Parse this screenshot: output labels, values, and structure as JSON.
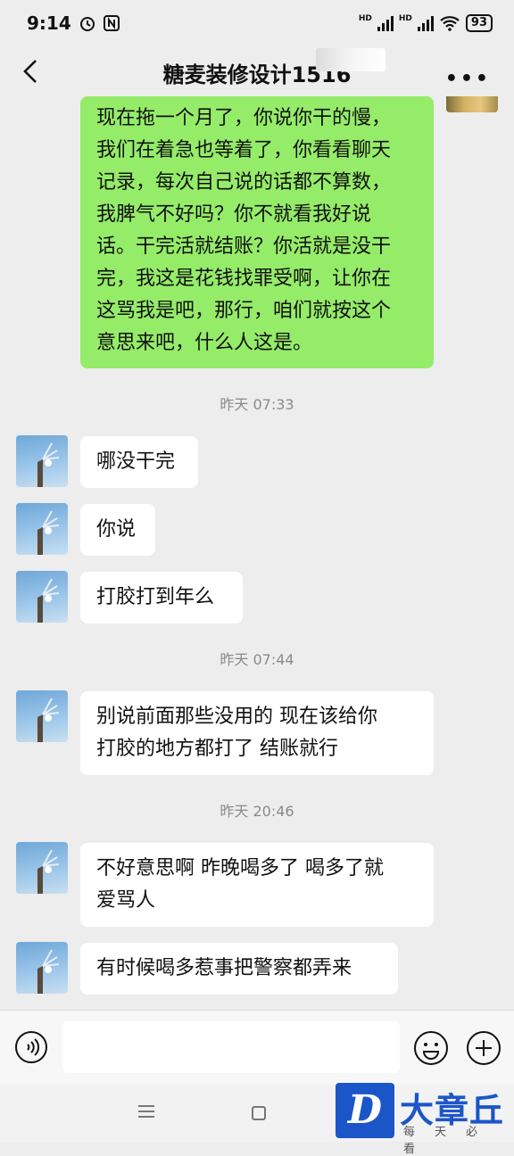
{
  "status_bar": {
    "time": "9:14",
    "battery": "93",
    "net1": "HD",
    "net2": "HD"
  },
  "header": {
    "title": "糖麦装修设计1516"
  },
  "messages": {
    "m1": "现在拖一个月了，你说你干的慢，\n我们在着急也等着了，你看看聊天\n记录，每次自己说的话都不算数，\n我脾气不好吗？你不就看我好说\n话。干完活就结账？你活就是没干\n完，我这是花钱找罪受啊，让你在\n这骂我是吧，那行，咱们就按这个\n意思来吧，什么人这是。",
    "t1": "昨天 07:33",
    "m2": "哪没干完",
    "m3": "你说",
    "m4": "打胶打到年么",
    "t2": "昨天 07:44",
    "m5": "别说前面那些没用的 现在该给你\n打胶的地方都打了 结账就行",
    "t3": "昨天 20:46",
    "m6": "不好意思啊 昨晚喝多了 喝多了就\n爱骂人",
    "m7": "有时候喝多惹事把警察都弄来"
  },
  "watermark": {
    "logo": "D",
    "name": "大章丘",
    "sub": "每天必看"
  },
  "colors": {
    "outgoing": "#95ec69",
    "incoming": "#ffffff",
    "background": "#ededed",
    "brand": "#1b56c9"
  }
}
